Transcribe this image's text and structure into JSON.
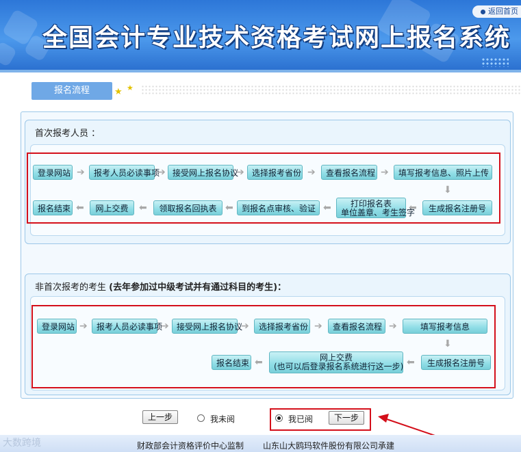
{
  "header": {
    "title": "全国会计专业技术资格考试网上报名系统",
    "back_link": "返回首页"
  },
  "tab": {
    "label": "报名流程"
  },
  "first_time": {
    "title": "首次报考人员 ：",
    "steps": [
      "登录网站",
      "报考人员必读事项",
      "接受网上报名协议",
      "选择报考省份",
      "查看报名流程",
      "填写报考信息、照片上传",
      "生成报名注册号",
      "打印报名表",
      "单位盖章、考生签字",
      "到报名点审核、验证",
      "领取报名回执表",
      "网上交费",
      "报名结束"
    ]
  },
  "returning": {
    "title": "非首次报考的考生",
    "title_note": "(去年参加过中级考试并有通过科目的考生)：",
    "steps": [
      "登录网站",
      "报考人员必读事项",
      "接受网上报名协议",
      "选择报考省份",
      "查看报名流程",
      "填写报考信息",
      "生成报名注册号",
      "网上交费",
      "(也可以后登录报名系统进行这一步)",
      "报名结束"
    ]
  },
  "controls": {
    "prev": "上一步",
    "not_read": "我未阅",
    "read": "我已阅",
    "next": "下一步",
    "selected": "read"
  },
  "footer": {
    "left": "财政部会计资格评价中心监制",
    "right": "山东山大鸥玛软件股份有限公司承建",
    "watermark": "大数跨境"
  },
  "colors": {
    "highlight_red": "#d40f1a",
    "button_teal": "#8fdde6",
    "banner_blue": "#3d8be2"
  }
}
